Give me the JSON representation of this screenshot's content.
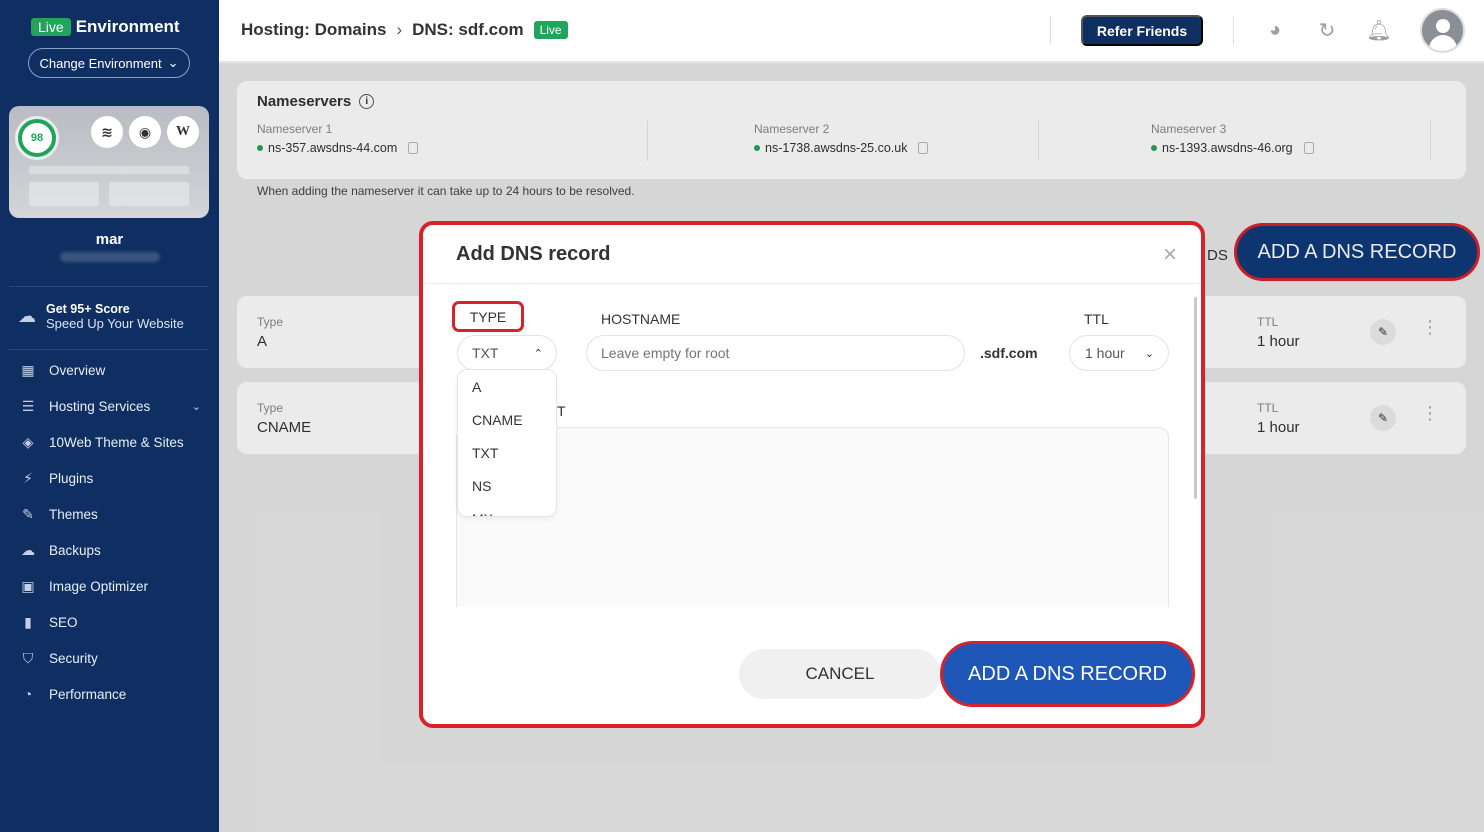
{
  "sidebar": {
    "env_badge": "Live",
    "env_title": "Environment",
    "change_env_label": "Change Environment",
    "score": "98",
    "user_name": "mar",
    "promo_title": "Get 95+ Score",
    "promo_sub": "Speed Up Your Website",
    "nav": [
      {
        "label": "Overview",
        "icon": "grid-icon"
      },
      {
        "label": "Hosting Services",
        "icon": "server-icon"
      },
      {
        "label": "10Web Theme & Sites",
        "icon": "layers-icon"
      },
      {
        "label": "Plugins",
        "icon": "plug-icon"
      },
      {
        "label": "Themes",
        "icon": "brush-icon"
      },
      {
        "label": "Backups",
        "icon": "cloud-icon"
      },
      {
        "label": "Image Optimizer",
        "icon": "image-icon"
      },
      {
        "label": "SEO",
        "icon": "bar-chart-icon"
      },
      {
        "label": "Security",
        "icon": "shield-icon"
      },
      {
        "label": "Performance",
        "icon": "gauge-icon"
      }
    ]
  },
  "header": {
    "crumb1": "Hosting: Domains",
    "crumb_sep": "›",
    "crumb2": "DNS: sdf.com",
    "live_badge": "Live",
    "refer_label": "Refer Friends"
  },
  "nameservers": {
    "title": "Nameservers",
    "items": [
      {
        "label": "Nameserver 1",
        "value": "ns-357.awsdns-44.com"
      },
      {
        "label": "Nameserver 2",
        "value": "ns-1738.awsdns-25.co.uk"
      },
      {
        "label": "Nameserver 3",
        "value": "ns-1393.awsdns-46.org"
      }
    ],
    "note": "When adding the nameserver it can take up to 24 hours to be resolved."
  },
  "page_add_button": "ADD A DNS RECORD",
  "partial_text": "DS",
  "records": [
    {
      "type_label": "Type",
      "type": "A",
      "ttl_label": "TTL",
      "ttl": "1 hour"
    },
    {
      "type_label": "Type",
      "type": "CNAME",
      "ttl_label": "TTL",
      "ttl": "1 hour"
    }
  ],
  "modal": {
    "title": "Add DNS record",
    "close": "×",
    "type_label": "TYPE",
    "hostname_label": "HOSTNAME",
    "ttl_label": "TTL",
    "type_value": "TXT",
    "hostname_placeholder": "Leave empty for root",
    "domain_suffix": ".sdf.com",
    "ttl_value": "1 hour",
    "text_label_partial": "T",
    "dropdown_options": [
      "A",
      "CNAME",
      "TXT",
      "NS",
      "MX"
    ],
    "cancel_label": "CANCEL",
    "submit_label": "ADD A DNS RECORD"
  }
}
